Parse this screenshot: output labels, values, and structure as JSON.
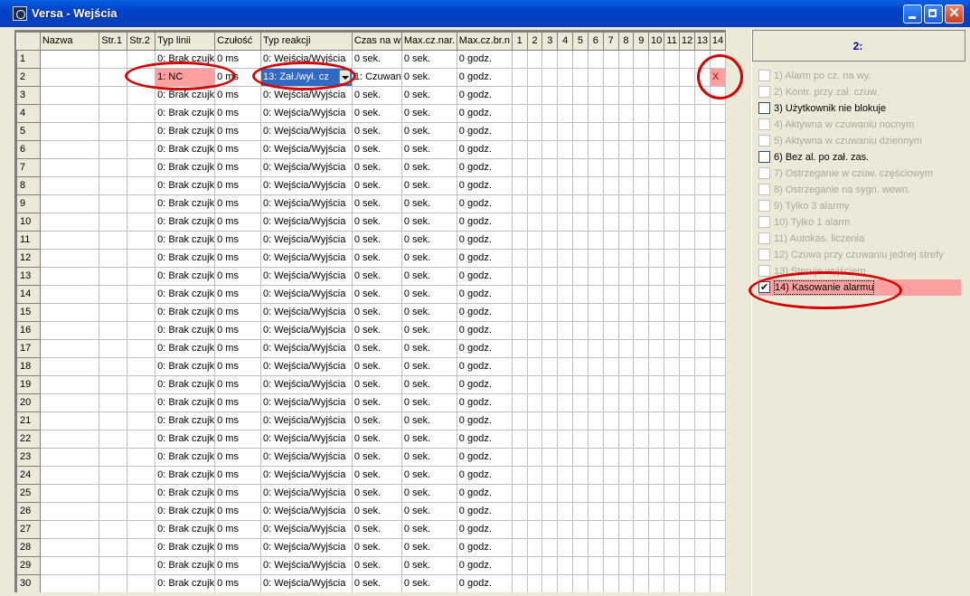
{
  "window": {
    "title": "Versa - Wejścia",
    "close_glyph": "✕"
  },
  "grid": {
    "headers": [
      "Nazwa",
      "Str.1",
      "Str.2",
      "Typ linii",
      "Czułość",
      "Typ reakcji",
      "Czas na w",
      "Max.cz.nar.",
      "Max.cz.br.n",
      "1",
      "2",
      "3",
      "4",
      "5",
      "6",
      "7",
      "8",
      "9",
      "10",
      "11",
      "12",
      "13",
      "14"
    ],
    "rows": [
      [
        "1",
        "",
        "",
        "",
        "0: Brak czujk",
        "0 ms",
        "0: Wejścia/Wyjścia",
        "0 sek.",
        "0 sek.",
        "0 godz."
      ],
      [
        "2",
        "",
        "",
        "",
        "1: NC",
        "0 ms",
        "13: Zał./wył. cz",
        "1: Czuwan",
        "0 sek.",
        "0 godz."
      ],
      [
        "3",
        "",
        "",
        "",
        "0: Brak czujk",
        "0 ms",
        "0: Wejścia/Wyjścia",
        "0 sek.",
        "0 sek.",
        "0 godz."
      ],
      [
        "4",
        "",
        "",
        "",
        "0: Brak czujk",
        "0 ms",
        "0: Wejścia/Wyjścia",
        "0 sek.",
        "0 sek.",
        "0 godz."
      ],
      [
        "5",
        "",
        "",
        "",
        "0: Brak czujk",
        "0 ms",
        "0: Wejścia/Wyjścia",
        "0 sek.",
        "0 sek.",
        "0 godz."
      ],
      [
        "6",
        "",
        "",
        "",
        "0: Brak czujk",
        "0 ms",
        "0: Wejścia/Wyjścia",
        "0 sek.",
        "0 sek.",
        "0 godz."
      ],
      [
        "7",
        "",
        "",
        "",
        "0: Brak czujk",
        "0 ms",
        "0: Wejścia/Wyjścia",
        "0 sek.",
        "0 sek.",
        "0 godz."
      ],
      [
        "8",
        "",
        "",
        "",
        "0: Brak czujk",
        "0 ms",
        "0: Wejścia/Wyjścia",
        "0 sek.",
        "0 sek.",
        "0 godz."
      ],
      [
        "9",
        "",
        "",
        "",
        "0: Brak czujk",
        "0 ms",
        "0: Wejścia/Wyjścia",
        "0 sek.",
        "0 sek.",
        "0 godz."
      ],
      [
        "10",
        "",
        "",
        "",
        "0: Brak czujk",
        "0 ms",
        "0: Wejścia/Wyjścia",
        "0 sek.",
        "0 sek.",
        "0 godz."
      ],
      [
        "11",
        "",
        "",
        "",
        "0: Brak czujk",
        "0 ms",
        "0: Wejścia/Wyjścia",
        "0 sek.",
        "0 sek.",
        "0 godz."
      ],
      [
        "12",
        "",
        "",
        "",
        "0: Brak czujk",
        "0 ms",
        "0: Wejścia/Wyjścia",
        "0 sek.",
        "0 sek.",
        "0 godz."
      ],
      [
        "13",
        "",
        "",
        "",
        "0: Brak czujk",
        "0 ms",
        "0: Wejścia/Wyjścia",
        "0 sek.",
        "0 sek.",
        "0 godz."
      ],
      [
        "14",
        "",
        "",
        "",
        "0: Brak czujk",
        "0 ms",
        "0: Wejścia/Wyjścia",
        "0 sek.",
        "0 sek.",
        "0 godz."
      ],
      [
        "15",
        "",
        "",
        "",
        "0: Brak czujk",
        "0 ms",
        "0: Wejścia/Wyjścia",
        "0 sek.",
        "0 sek.",
        "0 godz."
      ],
      [
        "16",
        "",
        "",
        "",
        "0: Brak czujk",
        "0 ms",
        "0: Wejścia/Wyjścia",
        "0 sek.",
        "0 sek.",
        "0 godz."
      ],
      [
        "17",
        "",
        "",
        "",
        "0: Brak czujk",
        "0 ms",
        "0: Wejścia/Wyjścia",
        "0 sek.",
        "0 sek.",
        "0 godz."
      ],
      [
        "18",
        "",
        "",
        "",
        "0: Brak czujk",
        "0 ms",
        "0: Wejścia/Wyjścia",
        "0 sek.",
        "0 sek.",
        "0 godz."
      ],
      [
        "19",
        "",
        "",
        "",
        "0: Brak czujk",
        "0 ms",
        "0: Wejścia/Wyjścia",
        "0 sek.",
        "0 sek.",
        "0 godz."
      ],
      [
        "20",
        "",
        "",
        "",
        "0: Brak czujk",
        "0 ms",
        "0: Wejścia/Wyjścia",
        "0 sek.",
        "0 sek.",
        "0 godz."
      ],
      [
        "21",
        "",
        "",
        "",
        "0: Brak czujk",
        "0 ms",
        "0: Wejścia/Wyjścia",
        "0 sek.",
        "0 sek.",
        "0 godz."
      ],
      [
        "22",
        "",
        "",
        "",
        "0: Brak czujk",
        "0 ms",
        "0: Wejścia/Wyjścia",
        "0 sek.",
        "0 sek.",
        "0 godz."
      ],
      [
        "23",
        "",
        "",
        "",
        "0: Brak czujk",
        "0 ms",
        "0: Wejścia/Wyjścia",
        "0 sek.",
        "0 sek.",
        "0 godz."
      ],
      [
        "24",
        "",
        "",
        "",
        "0: Brak czujk",
        "0 ms",
        "0: Wejścia/Wyjścia",
        "0 sek.",
        "0 sek.",
        "0 godz."
      ],
      [
        "25",
        "",
        "",
        "",
        "0: Brak czujk",
        "0 ms",
        "0: Wejścia/Wyjścia",
        "0 sek.",
        "0 sek.",
        "0 godz."
      ],
      [
        "26",
        "",
        "",
        "",
        "0: Brak czujk",
        "0 ms",
        "0: Wejścia/Wyjścia",
        "0 sek.",
        "0 sek.",
        "0 godz."
      ],
      [
        "27",
        "",
        "",
        "",
        "0: Brak czujk",
        "0 ms",
        "0: Wejścia/Wyjścia",
        "0 sek.",
        "0 sek.",
        "0 godz."
      ],
      [
        "28",
        "",
        "",
        "",
        "0: Brak czujk",
        "0 ms",
        "0: Wejścia/Wyjścia",
        "0 sek.",
        "0 sek.",
        "0 godz."
      ],
      [
        "29",
        "",
        "",
        "",
        "0: Brak czujk",
        "0 ms",
        "0: Wejścia/Wyjścia",
        "0 sek.",
        "0 sek.",
        "0 godz."
      ],
      [
        "30",
        "",
        "",
        "",
        "0: Brak czujk",
        "0 ms",
        "0: Wejścia/Wyjścia",
        "0 sek.",
        "0 sek.",
        "0 godz."
      ]
    ],
    "marked_cell": {
      "row": 2,
      "column": "14",
      "value": "X"
    },
    "highlight_color": "#ffa0a0",
    "selection_color": "#316ac5"
  },
  "panel": {
    "title": "2:",
    "options": [
      {
        "label": "1) Alarm po cz. na wy.",
        "enabled": false,
        "checked": false
      },
      {
        "label": "2) Kontr. przy zał. czuw.",
        "enabled": false,
        "checked": false
      },
      {
        "label": "3) Użytkownik nie blokuje",
        "enabled": true,
        "checked": false
      },
      {
        "label": "4) Aktywna w czuwaniu nocnym",
        "enabled": false,
        "checked": false
      },
      {
        "label": "5) Aktywna w czuwaniu dziennym",
        "enabled": false,
        "checked": false
      },
      {
        "label": "6) Bez al. po zał. zas.",
        "enabled": true,
        "checked": false
      },
      {
        "label": "7) Ostrzeganie w czuw. częściowym",
        "enabled": false,
        "checked": false
      },
      {
        "label": "8) Ostrzeganie na sygn. wewn.",
        "enabled": false,
        "checked": false
      },
      {
        "label": "9) Tylko 3 alarmy",
        "enabled": false,
        "checked": false
      },
      {
        "label": "10) Tylko 1 alarm",
        "enabled": false,
        "checked": false
      },
      {
        "label": "11) Autokas. liczenia",
        "enabled": false,
        "checked": false
      },
      {
        "label": "12) Czuwa przy czuwaniu jednej strefy",
        "enabled": false,
        "checked": false
      },
      {
        "label": "13) Steruje wyjściem",
        "enabled": false,
        "checked": false
      },
      {
        "label": "14) Kasowanie alarmu",
        "enabled": true,
        "checked": true
      }
    ]
  },
  "annotation_color": "#d40000"
}
